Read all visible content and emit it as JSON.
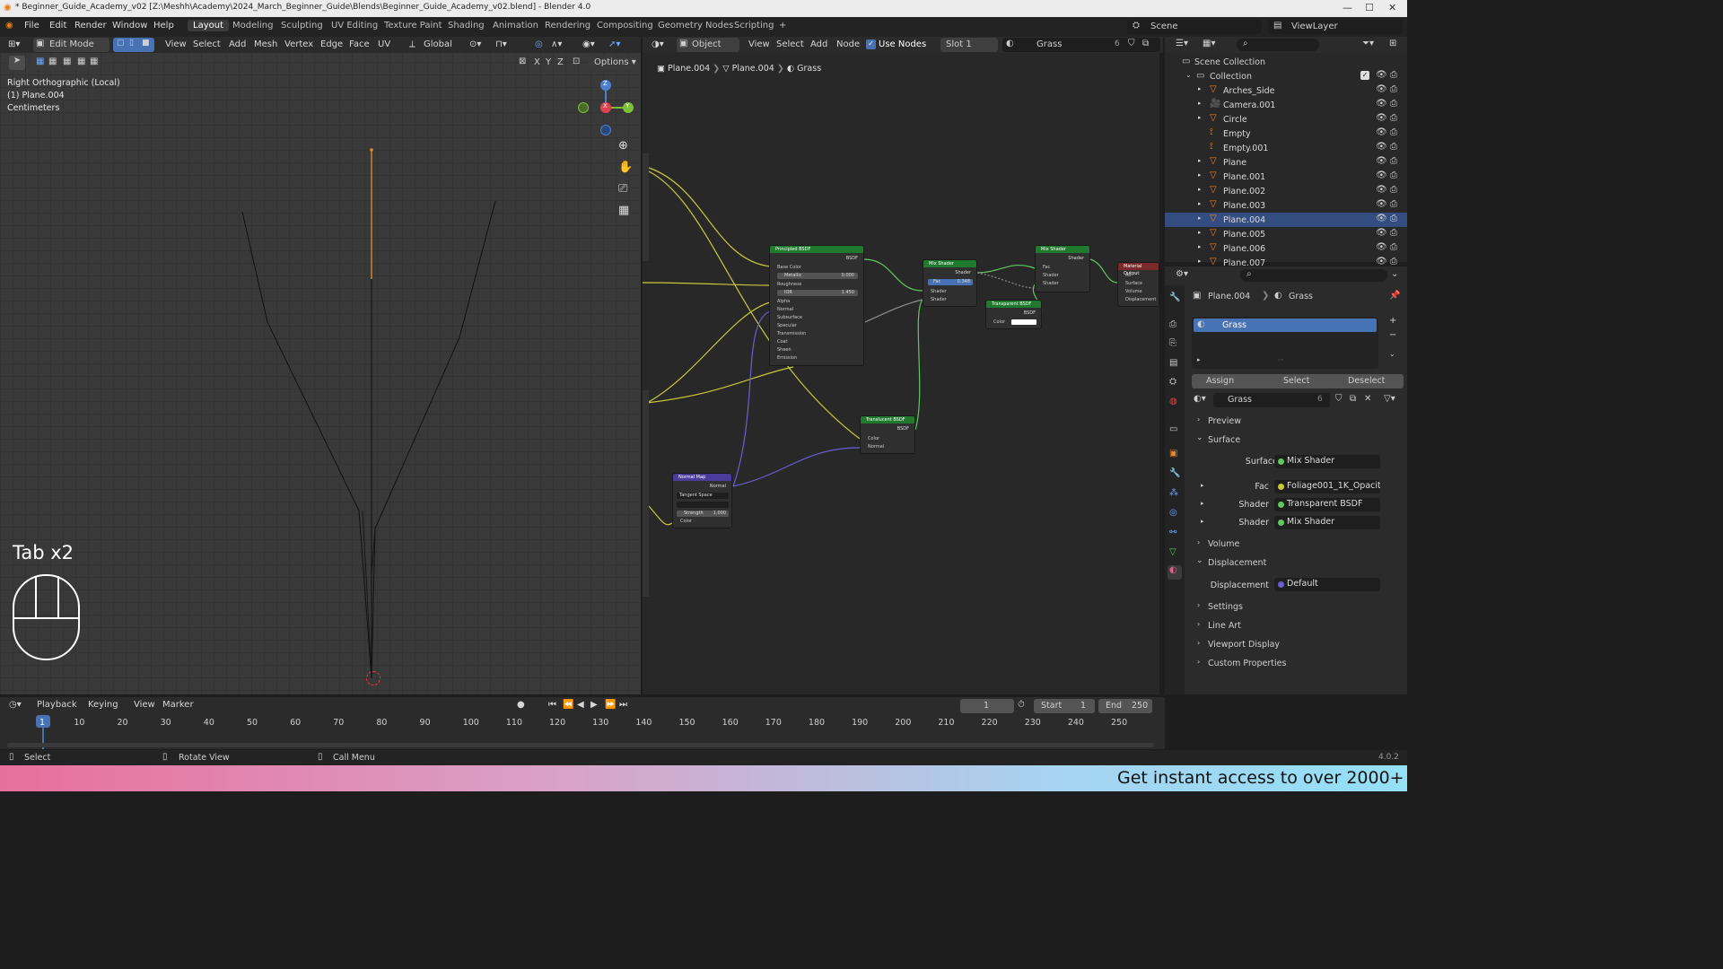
{
  "window": {
    "title": "* Beginner_Guide_Academy_v02 [Z:\\Meshh\\Academy\\2024_March_Beginner_Guide\\Blends\\Beginner_Guide_Academy_v02.blend] - Blender 4.0"
  },
  "menubar": {
    "items": [
      "File",
      "Edit",
      "Render",
      "Window",
      "Help"
    ],
    "workspaces": [
      "Layout",
      "Modeling",
      "Sculpting",
      "UV Editing",
      "Texture Paint",
      "Shading",
      "Animation",
      "Rendering",
      "Compositing",
      "Geometry Nodes",
      "Scripting"
    ],
    "active_workspace": "Layout",
    "add_tab": "+",
    "scene": "Scene",
    "view_layer": "ViewLayer"
  },
  "viewport": {
    "mode": "Edit Mode",
    "menus": [
      "View",
      "Select",
      "Add",
      "Mesh",
      "Vertex",
      "Edge",
      "Face",
      "UV"
    ],
    "orientation": "Global",
    "axes": [
      "X",
      "Y",
      "Z"
    ],
    "options": "Options",
    "view_name": "Right Orthographic (Local)",
    "object_line": "(1) Plane.004",
    "units": "Centimeters",
    "overlay_text": "Tab x2",
    "gizmo": {
      "z": "Z",
      "x": "X",
      "y": "Y"
    }
  },
  "node_editor": {
    "editor_type": "Object",
    "menus": [
      "View",
      "Select",
      "Add",
      "Node"
    ],
    "use_nodes": "Use Nodes",
    "slot": "Slot 1",
    "material": "Grass",
    "users": "6",
    "breadcrumb": [
      "Plane.004",
      "Plane.004",
      "Grass"
    ],
    "nodes": {
      "principled": {
        "title": "Principled BSDF",
        "output": "BSDF",
        "rows": [
          "Base Color",
          "Metallic",
          "Roughness",
          "IOR",
          "Alpha",
          "Normal",
          "Subsurface",
          "Specular",
          "Transmission",
          "Coat",
          "Sheen",
          "Emission"
        ],
        "metallic_value": "0.000",
        "ior_value": "1.450"
      },
      "mix1": {
        "title": "Mix Shader",
        "output": "Shader",
        "fac": "Fac",
        "fac_value": "0.348",
        "in1": "Shader",
        "in2": "Shader"
      },
      "mix2": {
        "title": "Mix Shader",
        "output": "Shader",
        "fac": "Fac",
        "in1": "Shader",
        "in2": "Shader"
      },
      "transparent": {
        "title": "Transparent BSDF",
        "output": "BSDF",
        "color": "Color"
      },
      "translucent": {
        "title": "Translucent BSDF",
        "output": "BSDF",
        "color": "Color",
        "normal": "Normal"
      },
      "normal_map": {
        "title": "Normal Map",
        "output": "Normal",
        "space": "Tangent Space",
        "strength": "Strength",
        "strength_value": "1.000",
        "color": "Color"
      },
      "output": {
        "title": "Material Output",
        "target": "All",
        "surface": "Surface",
        "volume": "Volume",
        "displacement": "Displacement"
      }
    }
  },
  "outliner": {
    "root": "Scene Collection",
    "collection": "Collection",
    "items": [
      "Arches_Side",
      "Camera.001",
      "Circle",
      "Empty",
      "Empty.001",
      "Plane",
      "Plane.001",
      "Plane.002",
      "Plane.003",
      "Plane.004",
      "Plane.005",
      "Plane.006",
      "Plane.007"
    ],
    "selected": "Plane.004"
  },
  "properties": {
    "breadcrumb_object": "Plane.004",
    "breadcrumb_material": "Grass",
    "slot_name": "Grass",
    "buttons": [
      "Assign",
      "Select",
      "Deselect"
    ],
    "material_name": "Grass",
    "users": "6",
    "sections": {
      "preview": "Preview",
      "surface": "Surface",
      "volume": "Volume",
      "displacement": "Displacement",
      "settings": "Settings",
      "line_art": "Line Art",
      "viewport_display": "Viewport Display",
      "custom_properties": "Custom Properties"
    },
    "surface_label": "Surface",
    "surface_value": "Mix Shader",
    "fac_label": "Fac",
    "fac_value": "Foliage001_1K_Opacit...",
    "shader1_label": "Shader",
    "shader1_value": "Transparent BSDF",
    "shader2_label": "Shader",
    "shader2_value": "Mix Shader",
    "displacement_label": "Displacement",
    "displacement_value": "Default"
  },
  "timeline": {
    "menus": [
      "Playback",
      "Keying",
      "View",
      "Marker"
    ],
    "current_frame": "1",
    "start_label": "Start",
    "start": "1",
    "end_label": "End",
    "end": "250",
    "ticks": [
      "1",
      "10",
      "20",
      "30",
      "40",
      "50",
      "60",
      "70",
      "80",
      "90",
      "100",
      "110",
      "120",
      "130",
      "140",
      "150",
      "160",
      "170",
      "180",
      "190",
      "200",
      "210",
      "220",
      "230",
      "240",
      "250"
    ]
  },
  "statusbar": {
    "select": "Select",
    "rotate": "Rotate View",
    "call_menu": "Call Menu",
    "version": "4.0.2"
  },
  "banner": {
    "text": "Get instant access to over 2000+"
  },
  "colors": {
    "accent": "#4772b3",
    "selected_row": "#334d80",
    "shader_header": "#1f7a2e",
    "vector_header": "#4b3c99",
    "output_header": "#7a2a2a",
    "wire_yellow": "#c7c93a",
    "wire_green": "#5fc85f",
    "wire_purple": "#6a5fd0",
    "wire_gray": "#8f8f8f"
  }
}
